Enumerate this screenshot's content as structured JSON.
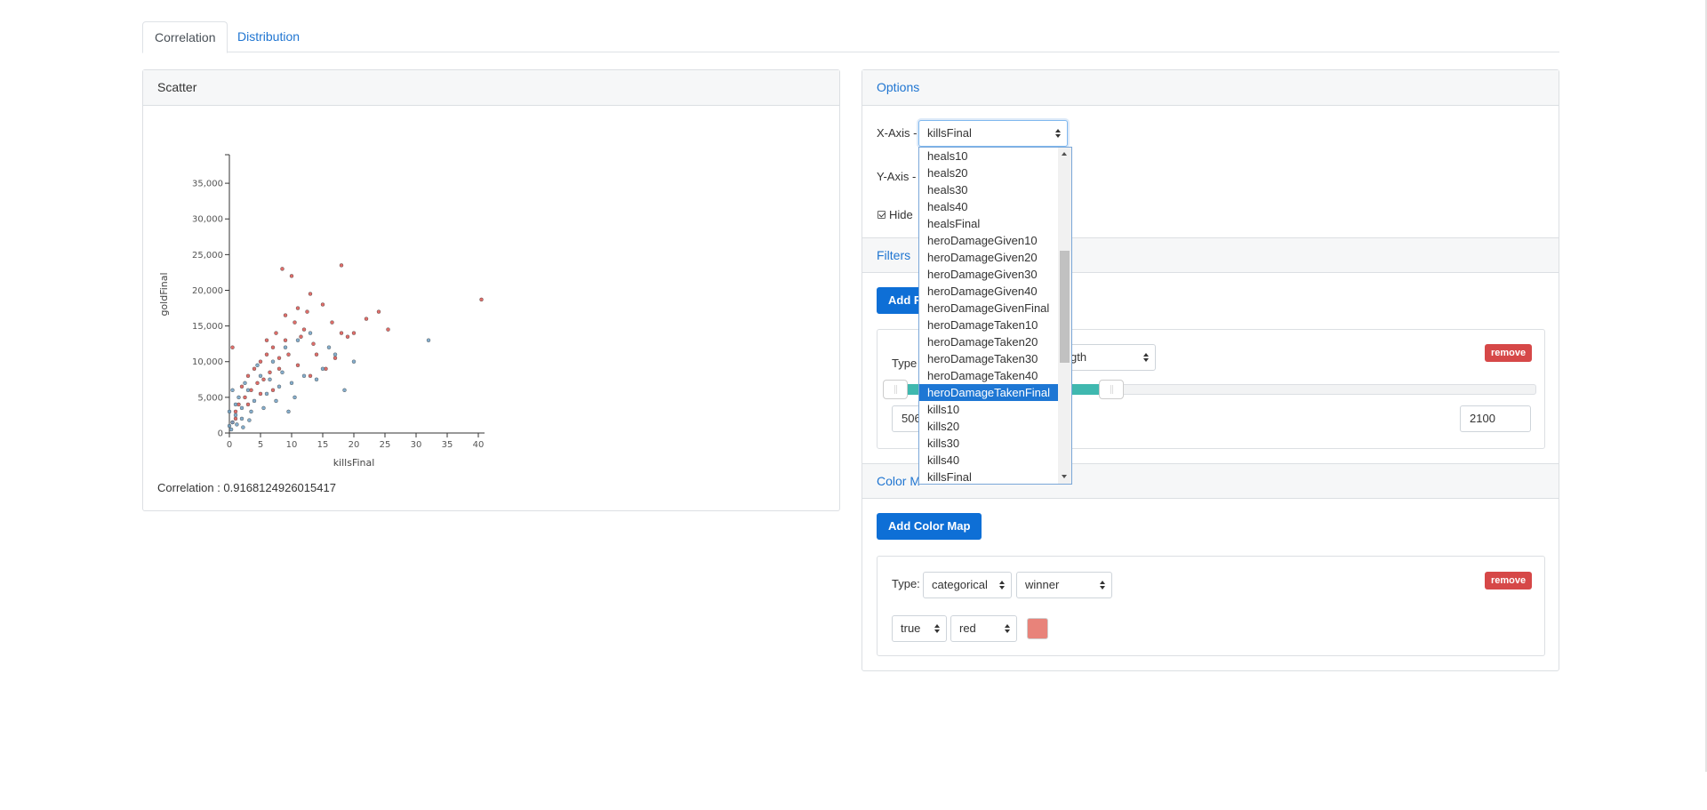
{
  "tabs": [
    {
      "label": "Correlation",
      "active": true
    },
    {
      "label": "Distribution",
      "active": false
    }
  ],
  "scatter": {
    "header": "Scatter",
    "correlation_text": "Correlation : 0.9168124926015417"
  },
  "chart_data": {
    "type": "scatter",
    "xlabel": "killsFinal",
    "ylabel": "goldFinal",
    "xlim": [
      0,
      41
    ],
    "ylim": [
      0,
      39000
    ],
    "xticks": [
      0,
      5,
      10,
      15,
      20,
      25,
      30,
      35,
      40
    ],
    "xtick_labels": [
      "0",
      "5",
      "10",
      "15",
      "20",
      "25",
      "30",
      "35",
      "40"
    ],
    "yticks": [
      0,
      5000,
      10000,
      15000,
      20000,
      25000,
      30000,
      35000
    ],
    "ytick_labels": [
      "0",
      "5,000",
      "10,000",
      "15,000",
      "20,000",
      "25,000",
      "30,000",
      "35,000"
    ],
    "series": [
      {
        "color": "#d9534f",
        "values": [
          [
            18,
            23500
          ],
          [
            8.5,
            23000
          ],
          [
            10,
            22000
          ],
          [
            40.5,
            18700
          ],
          [
            24,
            17000
          ],
          [
            13,
            19500
          ],
          [
            15,
            18000
          ],
          [
            11,
            17500
          ],
          [
            16.5,
            15500
          ],
          [
            22,
            16000
          ],
          [
            20,
            14000
          ],
          [
            12,
            14500
          ],
          [
            9,
            13000
          ],
          [
            7,
            12000
          ],
          [
            6,
            11000
          ],
          [
            5,
            10000
          ],
          [
            4,
            9000
          ],
          [
            3,
            8000
          ],
          [
            13.5,
            12500
          ],
          [
            14,
            11000
          ],
          [
            11,
            9500
          ],
          [
            8,
            9000
          ],
          [
            9.5,
            11000
          ],
          [
            6.5,
            8500
          ],
          [
            5.5,
            7500
          ],
          [
            3.5,
            6000
          ],
          [
            2.5,
            5000
          ],
          [
            1.5,
            4000
          ],
          [
            1,
            3000
          ],
          [
            0.5,
            12000
          ],
          [
            17,
            10500
          ],
          [
            19,
            13500
          ],
          [
            25.5,
            14500
          ],
          [
            10.5,
            15500
          ],
          [
            12.5,
            17000
          ],
          [
            7.5,
            14000
          ],
          [
            4.5,
            7000
          ],
          [
            2,
            6500
          ],
          [
            6,
            13000
          ],
          [
            9,
            16500
          ],
          [
            11.5,
            13500
          ],
          [
            8,
            10500
          ],
          [
            15.5,
            9000
          ],
          [
            18,
            14000
          ],
          [
            13,
            8000
          ],
          [
            7,
            6000
          ],
          [
            5,
            5500
          ],
          [
            3,
            4000
          ],
          [
            1,
            2000
          ],
          [
            0.5,
            1500
          ]
        ]
      },
      {
        "color": "#6f9fc3",
        "values": [
          [
            32,
            13000
          ],
          [
            20,
            10000
          ],
          [
            17,
            11000
          ],
          [
            15,
            9000
          ],
          [
            12,
            8000
          ],
          [
            10,
            7000
          ],
          [
            8,
            6500
          ],
          [
            6,
            5500
          ],
          [
            4,
            4500
          ],
          [
            2,
            3500
          ],
          [
            1,
            2500
          ],
          [
            0.5,
            1500
          ],
          [
            0,
            1000
          ],
          [
            3,
            6000
          ],
          [
            5,
            8000
          ],
          [
            7,
            10000
          ],
          [
            9,
            12000
          ],
          [
            11,
            13000
          ],
          [
            13,
            14000
          ],
          [
            1.5,
            5000
          ],
          [
            2.5,
            7000
          ],
          [
            4.5,
            9500
          ],
          [
            6.5,
            7500
          ],
          [
            8.5,
            8500
          ],
          [
            3.5,
            3000
          ],
          [
            2,
            2000
          ],
          [
            1,
            4000
          ],
          [
            0.5,
            6000
          ],
          [
            5.5,
            3500
          ],
          [
            7.5,
            4500
          ],
          [
            14,
            7500
          ],
          [
            16,
            12000
          ],
          [
            18.5,
            6000
          ],
          [
            10.5,
            5000
          ],
          [
            9.5,
            3000
          ],
          [
            0,
            3000
          ],
          [
            0.3,
            500
          ],
          [
            1.2,
            1200
          ],
          [
            2.2,
            800
          ],
          [
            3.2,
            1800
          ]
        ]
      }
    ]
  },
  "options": {
    "header": "Options",
    "x_axis_label": "X-Axis -",
    "x_axis_value": "killsFinal",
    "y_axis_label": "Y-Axis -",
    "hide_label": "Hide",
    "dropdown_options": [
      "heals10",
      "heals20",
      "heals30",
      "heals40",
      "healsFinal",
      "heroDamageGiven10",
      "heroDamageGiven20",
      "heroDamageGiven30",
      "heroDamageGiven40",
      "heroDamageGivenFinal",
      "heroDamageTaken10",
      "heroDamageTaken20",
      "heroDamageTaken30",
      "heroDamageTaken40",
      "heroDamageTakenFinal",
      "kills10",
      "kills20",
      "kills30",
      "kills40",
      "killsFinal"
    ],
    "dropdown_selected_index": 14
  },
  "filters": {
    "header": "Filters",
    "add_button": "Add F",
    "type_label": "Type",
    "type_select_value": "gth",
    "remove_label": "remove",
    "min_value": "506",
    "max_value": "2100",
    "range_fraction": [
      0.0,
      0.35
    ]
  },
  "color_mapping": {
    "header": "Color M",
    "add_button": "Add Color Map",
    "type_label": "Type:",
    "type_value": "categorical",
    "field_value": "winner",
    "remove_label": "remove",
    "key_value": "true",
    "color_value": "red",
    "swatch_color": "#e8837a"
  }
}
